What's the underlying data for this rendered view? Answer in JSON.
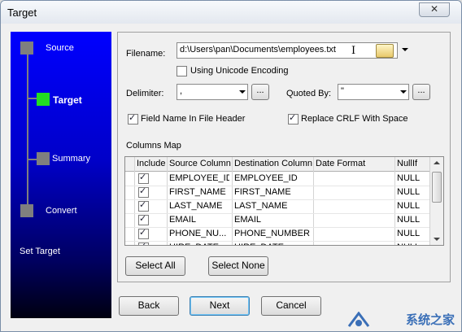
{
  "window": {
    "title": "Target",
    "close_glyph": "✕"
  },
  "nav": {
    "steps": [
      {
        "label": "Source",
        "active": false
      },
      {
        "label": "Target",
        "active": true
      },
      {
        "label": "Summary",
        "active": false
      },
      {
        "label": "Convert",
        "active": false
      }
    ],
    "footer": "Set Target"
  },
  "form": {
    "filename_label": "Filename:",
    "filename_value": "d:\\Users\\pan\\Documents\\employees.txt",
    "unicode_label": "Using Unicode Encoding",
    "unicode_checked": false,
    "delimiter_label": "Delimiter:",
    "delimiter_value": ",",
    "quoted_label": "Quoted By:",
    "quoted_value": "\"",
    "browse_label": "...",
    "field_header_label": "Field Name In File Header",
    "field_header_checked": true,
    "crlf_label": "Replace CRLF With Space",
    "crlf_checked": true,
    "columns_map_label": "Columns Map"
  },
  "grid": {
    "headers": [
      "Include",
      "Source Column",
      "Destination Column",
      "Date Format",
      "NullIf"
    ],
    "rows": [
      {
        "include": true,
        "source": "EMPLOYEE_ID",
        "dest": "EMPLOYEE_ID",
        "date_format": "",
        "nullif": "NULL"
      },
      {
        "include": true,
        "source": "FIRST_NAME",
        "dest": "FIRST_NAME",
        "date_format": "",
        "nullif": "NULL"
      },
      {
        "include": true,
        "source": "LAST_NAME",
        "dest": "LAST_NAME",
        "date_format": "",
        "nullif": "NULL"
      },
      {
        "include": true,
        "source": "EMAIL",
        "dest": "EMAIL",
        "date_format": "",
        "nullif": "NULL"
      },
      {
        "include": true,
        "source": "PHONE_NU...",
        "dest": "PHONE_NUMBER",
        "date_format": "",
        "nullif": "NULL"
      },
      {
        "include": true,
        "source": "HIRE_DATE",
        "dest": "HIRE_DATE",
        "date_format": "",
        "nullif": "NULL"
      }
    ]
  },
  "buttons": {
    "select_all": "Select All",
    "select_none": "Select None",
    "back": "Back",
    "next": "Next",
    "cancel": "Cancel"
  },
  "watermark": "系统之家",
  "colors": {
    "active_step": "#22dd22",
    "nav_top": "#0000ff",
    "nav_bottom": "#000010"
  },
  "icons": {
    "browse_folder": "folder-open-icon",
    "close": "close-icon"
  }
}
